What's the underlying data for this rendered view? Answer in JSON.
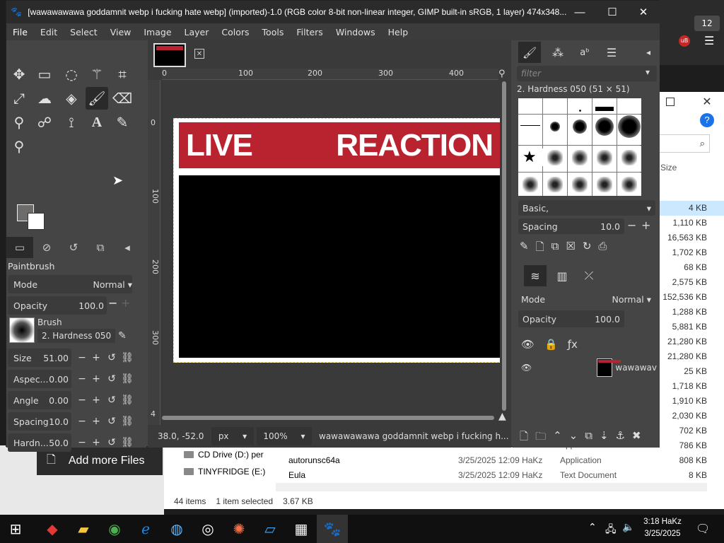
{
  "gimp": {
    "title": "[wawawawawa goddamnit webp i fucking hate webp] (imported)-1.0 (RGB color 8-bit non-linear integer, GIMP built-in sRGB, 1 layer) 474x348...",
    "menu": [
      "File",
      "Edit",
      "Select",
      "View",
      "Image",
      "Layer",
      "Colors",
      "Tools",
      "Filters",
      "Windows",
      "Help"
    ],
    "tool_options": {
      "panel_title": "Paintbrush",
      "mode_label": "Mode",
      "mode_value": "Normal",
      "opacity_label": "Opacity",
      "opacity_value": "100.0",
      "brush_label": "Brush",
      "brush_value": "2. Hardness 050",
      "size_label": "Size",
      "size_value": "51.00",
      "aspect_label": "Aspec...",
      "aspect_value": "0.00",
      "angle_label": "Angle",
      "angle_value": "0.00",
      "spacing_label": "Spacing",
      "spacing_value": "10.0",
      "hardness_label": "Hardn...",
      "hardness_value": "50.0"
    },
    "canvas": {
      "banner_left": "LIVE",
      "banner_right": "REACTION",
      "ruler_h": [
        "0",
        "100",
        "200",
        "300",
        "400"
      ],
      "ruler_v": [
        "0",
        "100",
        "200",
        "300",
        "4"
      ],
      "coords": "38.0, -52.0",
      "unit": "px",
      "zoom": "100%",
      "status_text": "wawawawawa goddamnit webp i fucking h..."
    },
    "brushes": {
      "filter_placeholder": "filter",
      "selected_label": "2. Hardness 050 (51 × 51)",
      "preset": "Basic,",
      "spacing_label": "Spacing",
      "spacing_value": "10.0"
    },
    "layers": {
      "mode_label": "Mode",
      "mode_value": "Normal",
      "opacity_label": "Opacity",
      "opacity_value": "100.0",
      "layer_name": "wawawav"
    }
  },
  "explorer": {
    "size_header": "Size",
    "sizes": [
      "4 KB",
      "1,110 KB",
      "16,563 KB",
      "1,702 KB",
      "68 KB",
      "2,575 KB",
      "152,536 KB",
      "1,288 KB",
      "5,881 KB",
      "21,280 KB",
      "21,280 KB",
      "25 KB",
      "1,718 KB",
      "1,910 KB",
      "2,030 KB",
      "702 KB",
      "786 KB",
      "808 KB",
      "8 KB"
    ],
    "nav": [
      "CD Drive (D:) per",
      "TINYFRIDGE (E:)"
    ],
    "files": [
      {
        "name": "autorunsc64",
        "date": "3/25/2025 12:09 HaKz",
        "type": "Application"
      },
      {
        "name": "autorunsc64a",
        "date": "3/25/2025 12:09 HaKz",
        "type": "Application"
      },
      {
        "name": "Eula",
        "date": "3/25/2025 12:09 HaKz",
        "type": "Text Document"
      }
    ],
    "status_items": "44 items",
    "status_selected": "1 item selected",
    "status_size": "3.67 KB"
  },
  "add_more_files": "Add more Files",
  "taskbar": {
    "time": "3:18 HaKz",
    "date": "3/25/2025"
  },
  "notification_count": "12"
}
